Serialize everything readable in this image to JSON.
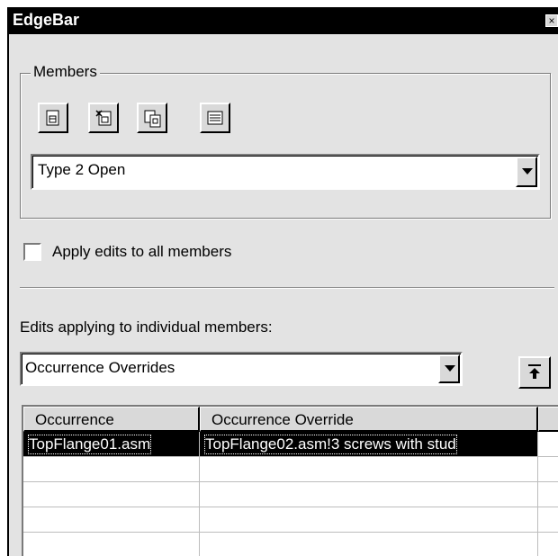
{
  "window": {
    "title": "EdgeBar",
    "close_glyph": "×"
  },
  "members": {
    "legend": "Members",
    "toolbar": [
      {
        "name": "add-member-icon"
      },
      {
        "name": "delete-member-icon"
      },
      {
        "name": "copy-member-icon"
      },
      {
        "name": "member-properties-icon"
      }
    ],
    "selected": "Type 2 Open"
  },
  "apply_all": {
    "label": "Apply edits to all members",
    "checked": false
  },
  "edits": {
    "label": "Edits applying to individual members:",
    "selected": "Occurrence Overrides",
    "table": {
      "columns": [
        "Occurrence",
        "Occurrence Override"
      ],
      "rows": [
        [
          "TopFlange01.asm",
          "TopFlange02.asm!3 screws with stud"
        ],
        [
          "",
          ""
        ],
        [
          "",
          ""
        ],
        [
          "",
          ""
        ],
        [
          "",
          ""
        ]
      ],
      "selected_row": 0
    }
  },
  "colors": {
    "face": "#e3e3e3",
    "titlebar": "#000000",
    "selection": "#000000"
  }
}
